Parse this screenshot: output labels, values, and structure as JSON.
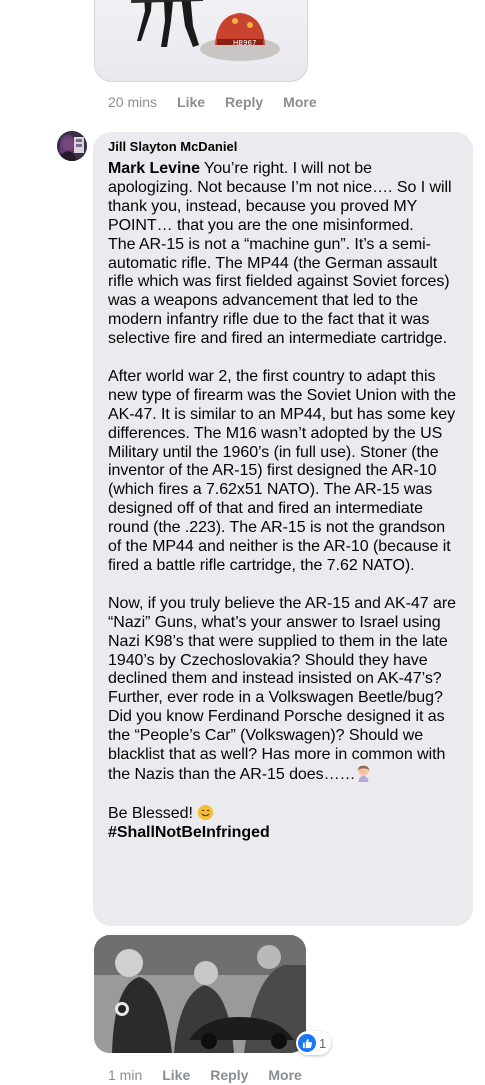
{
  "top_comment": {
    "time": "20 mins",
    "like_label": "Like",
    "reply_label": "Reply",
    "more_label": "More",
    "image_text": "HB967"
  },
  "main_comment": {
    "author": "Jill Slayton McDaniel",
    "mention": "Mark Levine",
    "paragraphs": [
      " You’re right. I will not be apologizing. Not because I’m not nice…. So I will thank you, instead, because you proved MY POINT… that you are the one misinformed.",
      "The AR-15 is not a “machine gun”. It’s a semi-automatic rifle. The MP44 (the German assault rifle which was first fielded against Soviet forces) was a weapons advancement that led to the modern infantry rifle due to the fact that it was selective fire and fired an intermediate cartridge.",
      "After world war 2, the first country to adapt this new type of firearm was the Soviet Union with the AK-47. It is similar to an MP44, but has some key differences. The M16 wasn’t adopted by the US Military until the 1960’s (in full use). Stoner (the inventor of the AR-15) first designed the AR-10 (which fires a 7.62x51 NATO). The AR-15 was designed off of that and fired an intermediate round (the .223). The AR-15 is not the grandson of the MP44 and neither is the AR-10 (because it fired a battle rifle cartridge, the 7.62 NATO).",
      "Now, if you truly believe the AR-15 and AK-47 are “Nazi” Guns, what’s your answer to Israel using Nazi K98’s that were supplied to them in the late 1940’s by Czechoslovakia? Should they have declined them and instead insisted on AK-47’s? Further, ever rode in a Volkswagen Beetle/bug? Did you know Ferdinand Porsche designed it as the “People’s Car” (Volkswagen)? Should we blacklist that as well? Has more in common with the Nazis than the AR-15 does……",
      "Be Blessed! "
    ],
    "hashtag": "#ShallNotBeInfringed"
  },
  "image_reply": {
    "time": "1 min",
    "like_label": "Like",
    "reply_label": "Reply",
    "more_label": "More",
    "reaction_count": "1"
  },
  "colors": {
    "bubble": "#eaeaef",
    "meta_text": "#8a8d91",
    "like_blue": "#1877f2"
  },
  "icons": [
    "woman-facepalming-emoji",
    "smiling-face-emoji",
    "like-thumb-icon"
  ]
}
